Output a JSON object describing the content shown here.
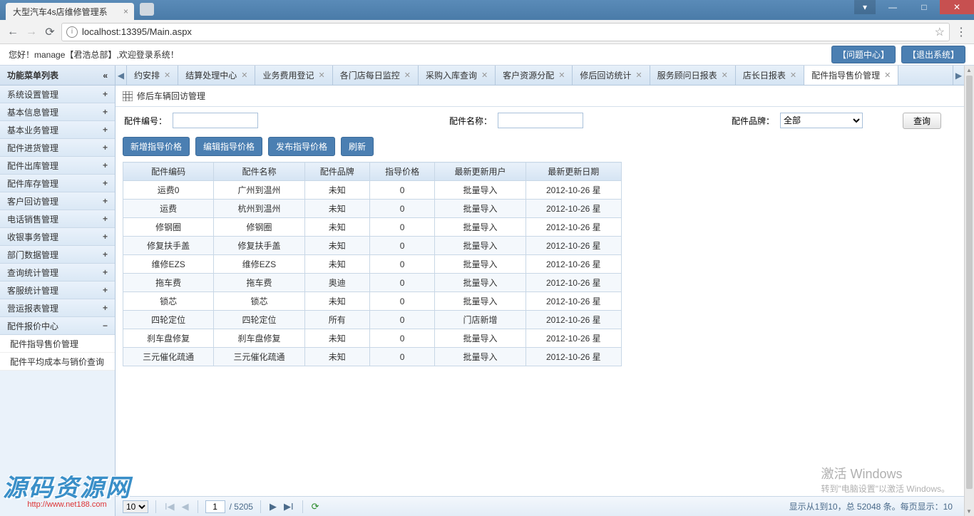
{
  "browser": {
    "tab_title": "大型汽车4s店维修管理系",
    "url": "localhost:13395/Main.aspx"
  },
  "header": {
    "welcome": "您好！manage【君浩总部】,欢迎登录系统！",
    "btn_issue": "【问题中心】",
    "btn_logout": "【退出系统】"
  },
  "sidebar": {
    "title": "功能菜单列表",
    "items": [
      {
        "label": "系统设置管理",
        "expanded": false
      },
      {
        "label": "基本信息管理",
        "expanded": false
      },
      {
        "label": "基本业务管理",
        "expanded": false
      },
      {
        "label": "配件进货管理",
        "expanded": false
      },
      {
        "label": "配件出库管理",
        "expanded": false
      },
      {
        "label": "配件库存管理",
        "expanded": false
      },
      {
        "label": "客户回访管理",
        "expanded": false
      },
      {
        "label": "电话销售管理",
        "expanded": false
      },
      {
        "label": "收银事务管理",
        "expanded": false
      },
      {
        "label": "部门数据管理",
        "expanded": false
      },
      {
        "label": "查询统计管理",
        "expanded": false
      },
      {
        "label": "客服统计管理",
        "expanded": false
      },
      {
        "label": "营运报表管理",
        "expanded": false
      },
      {
        "label": "配件报价中心",
        "expanded": true
      }
    ],
    "submenu": [
      {
        "label": "配件指导售价管理"
      },
      {
        "label": "配件平均成本与销价查询"
      }
    ]
  },
  "tabs": [
    {
      "label": "约安排"
    },
    {
      "label": "结算处理中心"
    },
    {
      "label": "业务费用登记"
    },
    {
      "label": "各门店每日监控"
    },
    {
      "label": "采购入库查询"
    },
    {
      "label": "客户资源分配"
    },
    {
      "label": "修后回访统计"
    },
    {
      "label": "服务顾问日报表"
    },
    {
      "label": "店长日报表"
    },
    {
      "label": "配件指导售价管理",
      "active": true
    }
  ],
  "panel": {
    "title": "修后车辆回访管理",
    "filters": {
      "code_label": "配件编号：",
      "code_value": "",
      "name_label": "配件名称：",
      "name_value": "",
      "brand_label": "配件品牌：",
      "brand_value": "全部",
      "query_btn": "查询"
    },
    "actions": {
      "new": "新增指导价格",
      "edit": "编辑指导价格",
      "publish": "发布指导价格",
      "refresh": "刷新"
    },
    "columns": [
      "配件编码",
      "配件名称",
      "配件品牌",
      "指导价格",
      "最新更新用户",
      "最新更新日期"
    ],
    "rows": [
      [
        "运费0",
        "广州到温州",
        "未知",
        "0",
        "批量导入",
        "2012-10-26 星"
      ],
      [
        "运费",
        "杭州到温州",
        "未知",
        "0",
        "批量导入",
        "2012-10-26 星"
      ],
      [
        "修钢圈",
        "修钢圈",
        "未知",
        "0",
        "批量导入",
        "2012-10-26 星"
      ],
      [
        "修复扶手盖",
        "修复扶手盖",
        "未知",
        "0",
        "批量导入",
        "2012-10-26 星"
      ],
      [
        "维修EZS",
        "维修EZS",
        "未知",
        "0",
        "批量导入",
        "2012-10-26 星"
      ],
      [
        "拖车费",
        "拖车费",
        "奥迪",
        "0",
        "批量导入",
        "2012-10-26 星"
      ],
      [
        "锁芯",
        "锁芯",
        "未知",
        "0",
        "批量导入",
        "2012-10-26 星"
      ],
      [
        "四轮定位",
        "四轮定位",
        "所有",
        "0",
        "门店新增",
        "2012-10-26 星"
      ],
      [
        "刹车盘修复",
        "刹车盘修复",
        "未知",
        "0",
        "批量导入",
        "2012-10-26 星"
      ],
      [
        "三元催化疏通",
        "三元催化疏通",
        "未知",
        "0",
        "批量导入",
        "2012-10-26 星"
      ]
    ],
    "pager": {
      "page_size": "10",
      "current_page": "1",
      "total_pages": "/ 5205",
      "info": "显示从1到10，总 52048 条。每页显示：10"
    }
  },
  "watermark": {
    "main": "源码资源网",
    "sub": "http://www.net188.com"
  },
  "activate": {
    "l1": "激活 Windows",
    "l2": "转到\"电脑设置\"以激活 Windows。"
  }
}
